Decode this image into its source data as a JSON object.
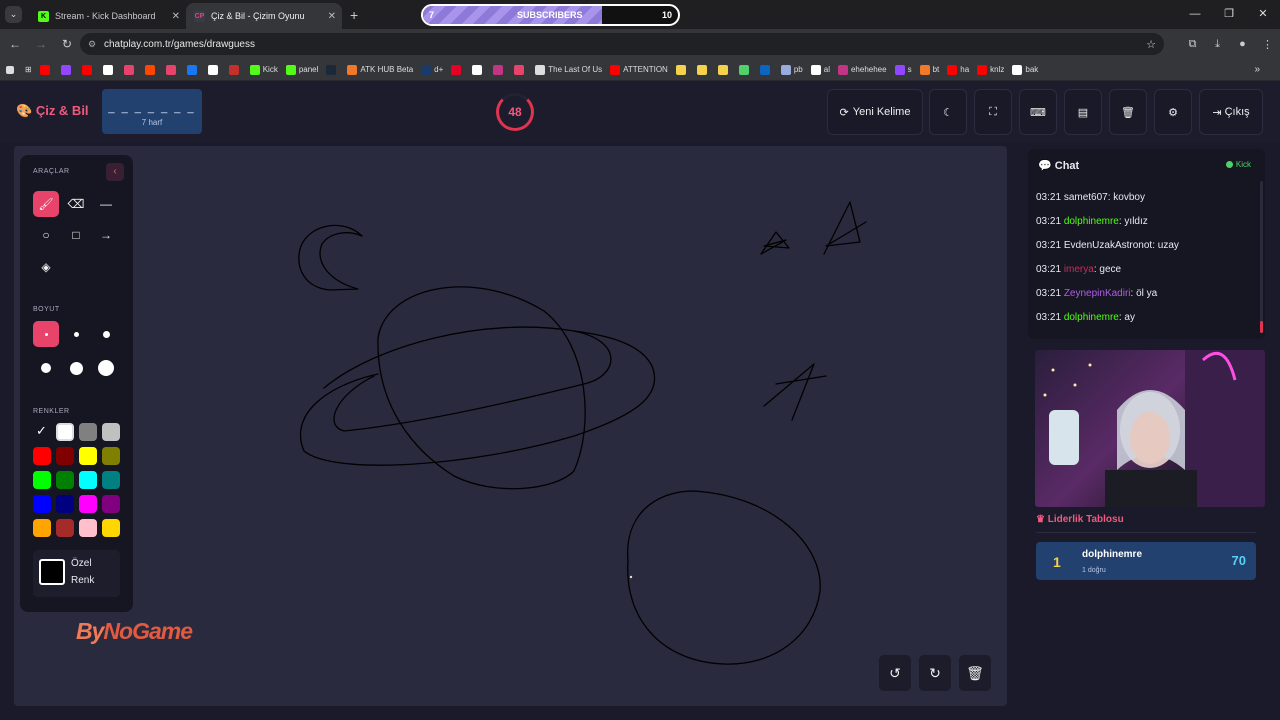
{
  "browser": {
    "tabs": [
      {
        "title": "Stream - Kick Dashboard",
        "fav": "K",
        "fav_color": "#53fc18",
        "active": false
      },
      {
        "title": "Çiz & Bil - Çizim Oyunu",
        "fav": "CP",
        "fav_color": "#e8436a",
        "active": true
      }
    ],
    "url": "chatplay.com.tr/games/drawguess",
    "subs_goal": {
      "current": "7",
      "label": "SUBSCRIBERS",
      "target": "10",
      "progress": 0.7
    },
    "bookmarks": [
      {
        "label": "",
        "color": "#ff0000"
      },
      {
        "label": "",
        "color": "#9146ff"
      },
      {
        "label": "",
        "color": "#ff0000"
      },
      {
        "label": "",
        "color": "#ffffff"
      },
      {
        "label": "",
        "color": "#e8436a"
      },
      {
        "label": "",
        "color": "#ff4500"
      },
      {
        "label": "",
        "color": "#e8436a"
      },
      {
        "label": "",
        "color": "#1877f2"
      },
      {
        "label": "",
        "color": "#ffffff"
      },
      {
        "label": "",
        "color": "#c4302b"
      },
      {
        "label": "Kick",
        "color": "#53fc18"
      },
      {
        "label": "panel",
        "color": "#53fc18"
      },
      {
        "label": "",
        "color": "#1b2838"
      },
      {
        "label": "ATK HUB Beta",
        "color": "#f07a2a"
      },
      {
        "label": "d+",
        "color": "#1a3a6a"
      },
      {
        "label": "",
        "color": "#e60023"
      },
      {
        "label": "",
        "color": "#ffffff"
      },
      {
        "label": "",
        "color": "#c13584"
      },
      {
        "label": "",
        "color": "#e8436a"
      },
      {
        "label": "The Last Of Us",
        "color": "#dddddd"
      },
      {
        "label": "ATTENTION",
        "color": "#ff0000"
      },
      {
        "label": "",
        "color": "#f5d24a"
      },
      {
        "label": "",
        "color": "#f5d24a"
      },
      {
        "label": "",
        "color": "#f5d24a"
      },
      {
        "label": "",
        "color": "#4fd06a"
      },
      {
        "label": "",
        "color": "#0a66c2"
      },
      {
        "label": "pb",
        "color": "#9ad"
      },
      {
        "label": "al",
        "color": "#ffffff"
      },
      {
        "label": "ehehehee",
        "color": "#c13584"
      },
      {
        "label": "s",
        "color": "#9146ff"
      },
      {
        "label": "bt",
        "color": "#f07a2a"
      },
      {
        "label": "ha",
        "color": "#ff0000"
      },
      {
        "label": "knlz",
        "color": "#ff0000"
      },
      {
        "label": "bak",
        "color": "#ffffff"
      }
    ]
  },
  "header": {
    "logo": "Çiz & Bil",
    "word_mask": "_ _ _ _ _ _ _",
    "word_hint": "7 harf",
    "timer": "48",
    "new_word": "Yeni Kelime",
    "logout": "Çıkış"
  },
  "tools": {
    "section_tools": "ARAÇLAR",
    "section_size": "BOYUT",
    "section_colors": "RENKLER",
    "custom_line1": "Özel",
    "custom_line2": "Renk",
    "colors": [
      "#000000",
      "#ffffff",
      "#808080",
      "#c0c0c0",
      "#ff0000",
      "#800000",
      "#ffff00",
      "#808000",
      "#00ff00",
      "#008000",
      "#00ffff",
      "#008080",
      "#0000ff",
      "#000080",
      "#ff00ff",
      "#800080",
      "#ffa500",
      "#a52a2a",
      "#ffc0cb",
      "#ffd700"
    ]
  },
  "brand": {
    "part1": "By",
    "part2": "NoGame"
  },
  "chat": {
    "title": "Chat",
    "platform": "Kick",
    "messages": [
      {
        "time": "03:21",
        "user": "samet607",
        "color": "#e8e8f0",
        "text": "kovboy"
      },
      {
        "time": "03:21",
        "user": "dolphinemre",
        "color": "#53fc18",
        "text": "yıldız"
      },
      {
        "time": "03:21",
        "user": "EvdenUzakAstronot",
        "color": "#e8e8f0",
        "text": "uzay"
      },
      {
        "time": "03:21",
        "user": "imerya",
        "color": "#c0305a",
        "text": "gece"
      },
      {
        "time": "03:21",
        "user": "ZeynepinKadiri",
        "color": "#b05ce6",
        "text": "öl ya"
      },
      {
        "time": "03:21",
        "user": "dolphinemre",
        "color": "#53fc18",
        "text": "ay"
      }
    ]
  },
  "leaderboard": {
    "title": "Liderlik Tablosu",
    "rows": [
      {
        "rank": "1",
        "name": "dolphinemre",
        "sub": "1 doğru",
        "score": "70"
      }
    ]
  }
}
